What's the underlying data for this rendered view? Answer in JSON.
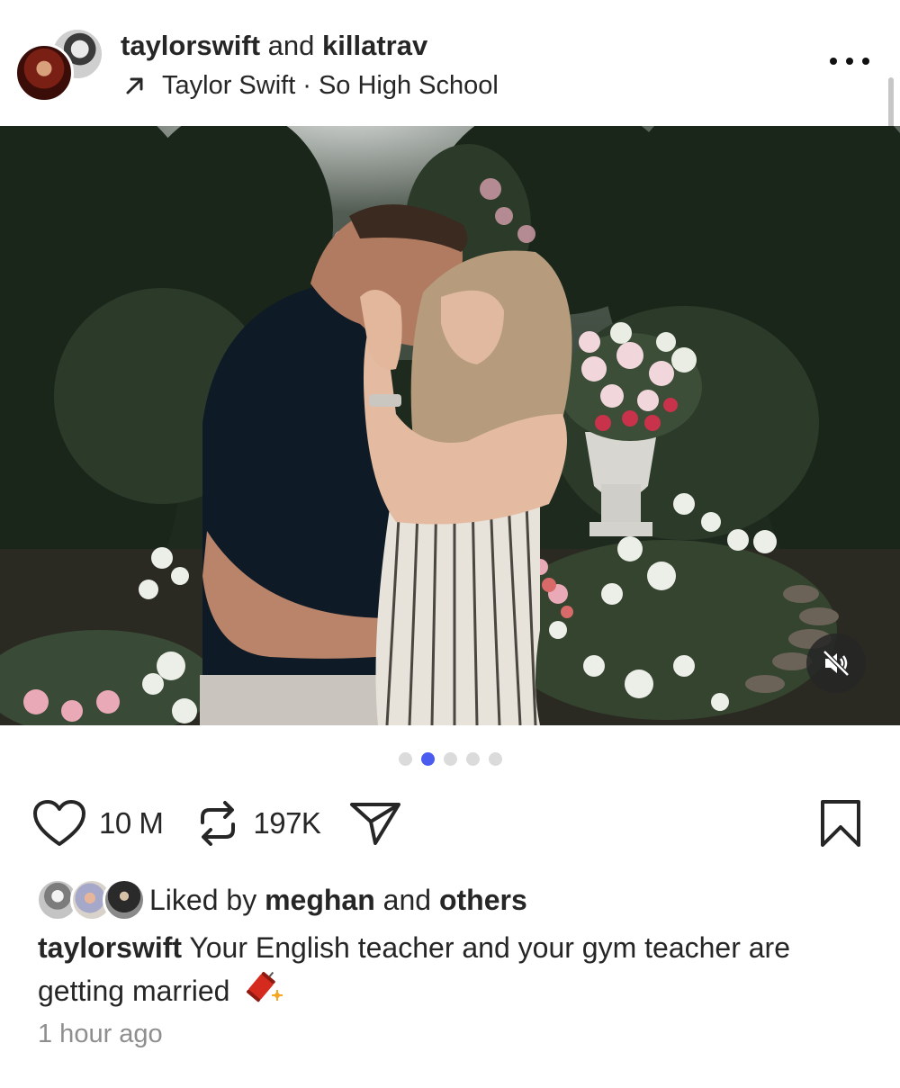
{
  "header": {
    "user1": "taylorswift",
    "joiner": "and",
    "user2": "killatrav",
    "music_artist": "Taylor Swift",
    "separator": "·",
    "music_track": "So High School",
    "more_icon": "ellipsis-icon",
    "music_icon": "arrow-up-right-icon"
  },
  "media": {
    "carousel_total": 5,
    "carousel_active": 2,
    "mute_icon": "muted-speaker-icon"
  },
  "actions": {
    "like_icon": "heart-icon",
    "like_count": "10 M",
    "repost_icon": "repost-icon",
    "repost_count": "197K",
    "share_icon": "send-icon",
    "save_icon": "bookmark-icon"
  },
  "likes": {
    "prefix": "Liked by",
    "user": "meghan",
    "joiner": "and",
    "others": "others"
  },
  "caption": {
    "username": "taylorswift",
    "text": "Your English teacher and your gym teacher are getting married",
    "emoji_icon": "firecracker-icon"
  },
  "timestamp": "1 hour ago",
  "colors": {
    "active_dot": "#4a5cf0",
    "inactive_dot": "#dbdbdb",
    "muted_text": "#8e8e8e"
  }
}
